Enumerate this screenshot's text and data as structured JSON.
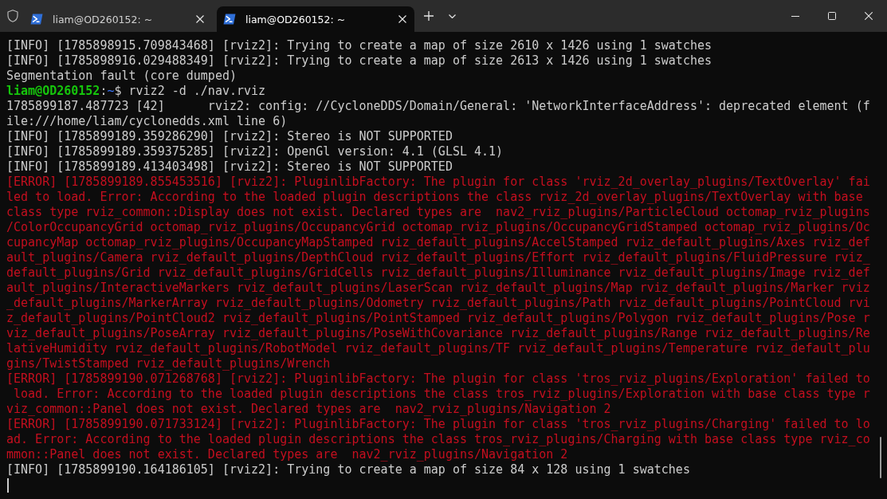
{
  "tabs": [
    {
      "title": "liam@OD260152: ~",
      "selected": false
    },
    {
      "title": "liam@OD260152: ~",
      "selected": true
    }
  ],
  "terminal": {
    "lines": [
      {
        "kind": "output",
        "text": "[INFO] [1785898915.709843468] [rviz2]: Trying to create a map of size 2610 x 1426 using 1 swatches"
      },
      {
        "kind": "output",
        "text": "[INFO] [1785898916.029488349] [rviz2]: Trying to create a map of size 2613 x 1426 using 1 swatches"
      },
      {
        "kind": "output",
        "text": "Segmentation fault (core dumped)"
      },
      {
        "kind": "prompt",
        "segments": [
          {
            "kind": "user",
            "text": "liam@OD260152"
          },
          {
            "kind": "plain",
            "text": ":"
          },
          {
            "kind": "path",
            "text": "~"
          },
          {
            "kind": "plain",
            "text": "$ rviz2 -d ./nav.rviz"
          }
        ]
      },
      {
        "kind": "output",
        "text": "1785899187.487723 [42]      rviz2: config: //CycloneDDS/Domain/General: 'NetworkInterfaceAddress': deprecated element (file:///home/liam/cyclonedds.xml line 6)"
      },
      {
        "kind": "output",
        "text": "[INFO] [1785899189.359286290] [rviz2]: Stereo is NOT SUPPORTED"
      },
      {
        "kind": "output",
        "text": "[INFO] [1785899189.359375285] [rviz2]: OpenGl version: 4.1 (GLSL 4.1)"
      },
      {
        "kind": "output",
        "text": "[INFO] [1785899189.413403498] [rviz2]: Stereo is NOT SUPPORTED"
      },
      {
        "kind": "error",
        "text": "[ERROR] [1785899189.855453516] [rviz2]: PluginlibFactory: The plugin for class 'rviz_2d_overlay_plugins/TextOverlay' failed to load. Error: According to the loaded plugin descriptions the class rviz_2d_overlay_plugins/TextOverlay with base class type rviz_common::Display does not exist. Declared types are  nav2_rviz_plugins/ParticleCloud octomap_rviz_plugins/ColorOccupancyGrid octomap_rviz_plugins/OccupancyGrid octomap_rviz_plugins/OccupancyGridStamped octomap_rviz_plugins/OccupancyMap octomap_rviz_plugins/OccupancyMapStamped rviz_default_plugins/AccelStamped rviz_default_plugins/Axes rviz_default_plugins/Camera rviz_default_plugins/DepthCloud rviz_default_plugins/Effort rviz_default_plugins/FluidPressure rviz_default_plugins/Grid rviz_default_plugins/GridCells rviz_default_plugins/Illuminance rviz_default_plugins/Image rviz_default_plugins/InteractiveMarkers rviz_default_plugins/LaserScan rviz_default_plugins/Map rviz_default_plugins/Marker rviz_default_plugins/MarkerArray rviz_default_plugins/Odometry rviz_default_plugins/Path rviz_default_plugins/PointCloud rviz_default_plugins/PointCloud2 rviz_default_plugins/PointStamped rviz_default_plugins/Polygon rviz_default_plugins/Pose rviz_default_plugins/PoseArray rviz_default_plugins/PoseWithCovariance rviz_default_plugins/Range rviz_default_plugins/RelativeHumidity rviz_default_plugins/RobotModel rviz_default_plugins/TF rviz_default_plugins/Temperature rviz_default_plugins/TwistStamped rviz_default_plugins/Wrench"
      },
      {
        "kind": "error",
        "text": "[ERROR] [1785899190.071268768] [rviz2]: PluginlibFactory: The plugin for class 'tros_rviz_plugins/Exploration' failed to load. Error: According to the loaded plugin descriptions the class tros_rviz_plugins/Exploration with base class type rviz_common::Panel does not exist. Declared types are  nav2_rviz_plugins/Navigation 2"
      },
      {
        "kind": "error",
        "text": "[ERROR] [1785899190.071733124] [rviz2]: PluginlibFactory: The plugin for class 'tros_rviz_plugins/Charging' failed to load. Error: According to the loaded plugin descriptions the class tros_rviz_plugins/Charging with base class type rviz_common::Panel does not exist. Declared types are  nav2_rviz_plugins/Navigation 2"
      },
      {
        "kind": "output",
        "text": "[INFO] [1785899190.164186105] [rviz2]: Trying to create a map of size 84 x 128 using 1 swatches"
      }
    ]
  }
}
